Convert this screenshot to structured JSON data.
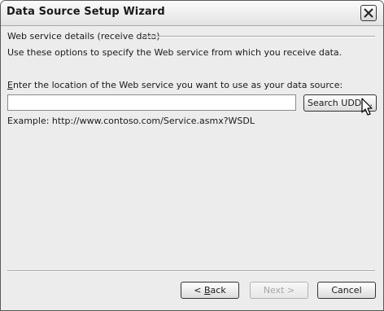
{
  "window": {
    "title": "Data Source Setup Wizard",
    "close_icon": "close-icon"
  },
  "section": {
    "heading": "Web service details (receive data)",
    "description": "Use these options to specify the Web service from which you receive data."
  },
  "location": {
    "label_mnemonic": "E",
    "label_rest": "nter the location of the Web service you want to use as your data source:",
    "value": "",
    "search_button_label": "Search UDDI...",
    "example": "Example: http://www.contoso.com/Service.asmx?WSDL"
  },
  "footer": {
    "back_mnemonic": "B",
    "back_rest": "ack",
    "back_prefix": "< ",
    "next_label": "Next >",
    "cancel_label": "Cancel"
  },
  "pointer_icon": "mouse-cursor-icon"
}
